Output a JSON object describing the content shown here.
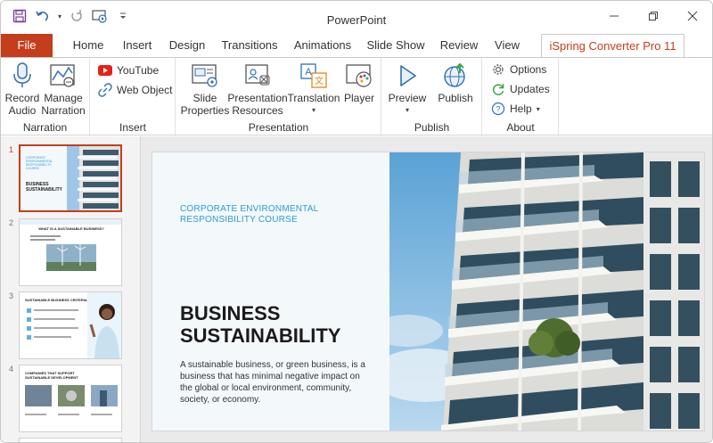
{
  "app": {
    "title": "PowerPoint"
  },
  "titlebar": {
    "qat_icons": [
      "save-icon",
      "undo-icon",
      "redo-icon",
      "present-icon",
      "customize-icon"
    ],
    "window_controls": [
      "minimize-icon",
      "restore-icon",
      "close-icon"
    ]
  },
  "tabs": [
    {
      "label": "File"
    },
    {
      "label": "Home"
    },
    {
      "label": "Insert"
    },
    {
      "label": "Design"
    },
    {
      "label": "Transitions"
    },
    {
      "label": "Animations"
    },
    {
      "label": "Slide Show"
    },
    {
      "label": "Review"
    },
    {
      "label": "View"
    },
    {
      "label": "iSpring Converter Pro 11"
    }
  ],
  "ribbon": {
    "narration": {
      "label": "Narration",
      "record_line1": "Record",
      "record_line2": "Audio",
      "manage_line1": "Manage",
      "manage_line2": "Narration"
    },
    "insert": {
      "label": "Insert",
      "youtube": "YouTube",
      "web_object": "Web Object"
    },
    "presentation": {
      "label": "Presentation",
      "slide_props_line1": "Slide",
      "slide_props_line2": "Properties",
      "pres_res_line1": "Presentation",
      "pres_res_line2": "Resources",
      "translation": "Translation",
      "player": "Player"
    },
    "publish": {
      "label": "Publish",
      "preview": "Preview",
      "publish": "Publish"
    },
    "about": {
      "label": "About",
      "options": "Options",
      "updates": "Updates",
      "help": "Help"
    }
  },
  "thumbnails": [
    {
      "number": "1",
      "title": "BUSINESS SUSTAINABILITY",
      "subtitle": "CORPORATE ENVIRONMENTAL RESPONSIBILITY COURSE"
    },
    {
      "number": "2",
      "title": "WHAT IS A SUSTAINABLE BUSINESS?"
    },
    {
      "number": "3",
      "title": "SUSTAINABLE BUSINESS CRITERIA"
    },
    {
      "number": "4",
      "title": "COMPANIES THAT SUPPORT SUSTAINABLE DEVELOPMENT"
    }
  ],
  "slide": {
    "subtitle": "CORPORATE ENVIRONMENTAL RESPONSIBILITY COURSE",
    "title_line1": "BUSINESS",
    "title_line2": "SUSTAINABILITY",
    "body": "A sustainable business, or green business, is a business that has minimal negative impact on the global or local environment, community, society, or economy."
  },
  "colors": {
    "accent": "#c43e1c",
    "slide_subtitle": "#2f9bd6",
    "slide_bg": "#f3f8fb"
  }
}
